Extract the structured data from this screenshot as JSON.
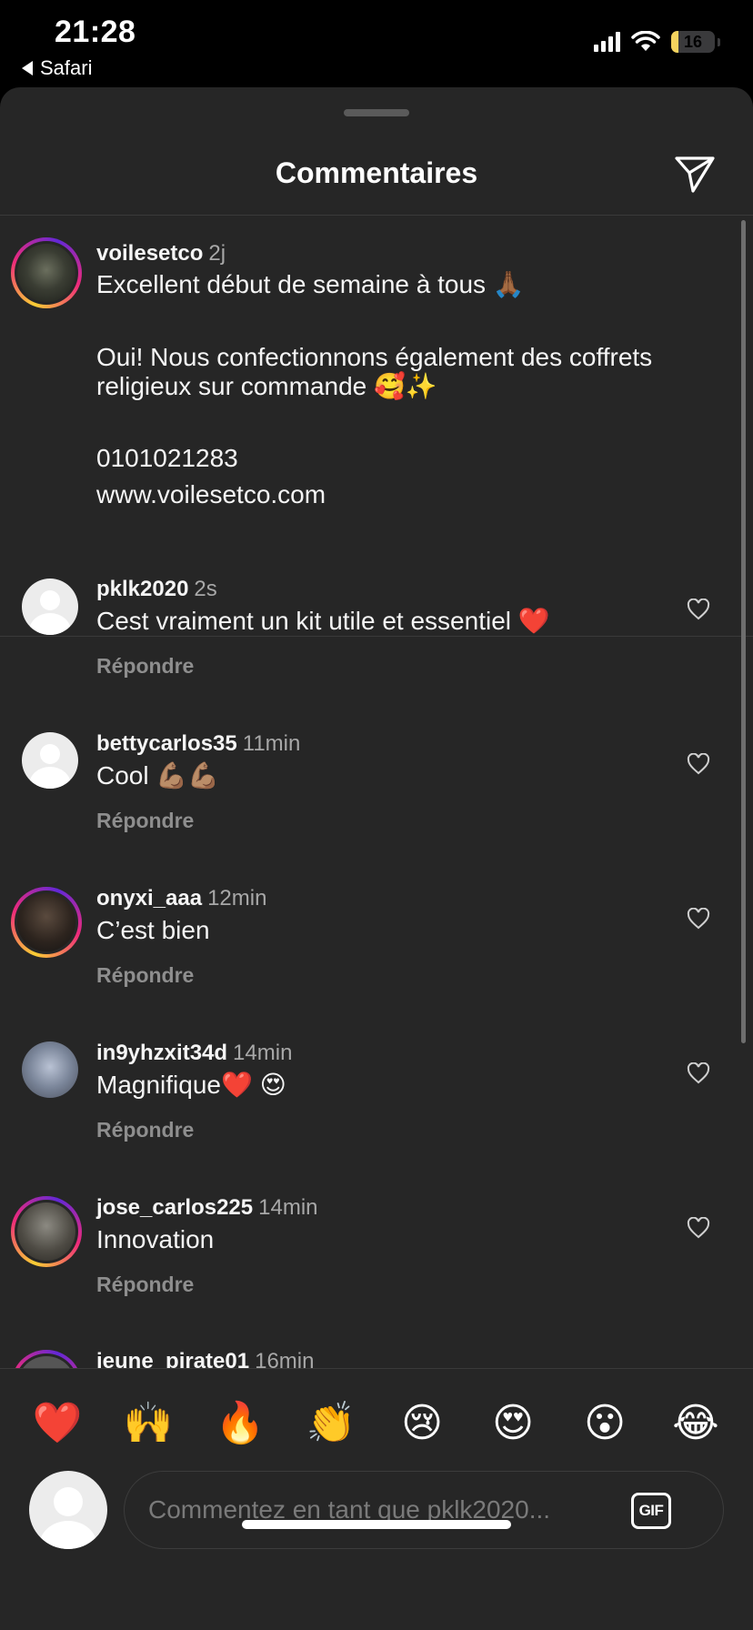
{
  "status_bar": {
    "time": "21:28",
    "back_app": "Safari",
    "battery": "16",
    "battery_level": 0.16,
    "icons": [
      "cellular-signal-icon",
      "wifi-icon",
      "battery-icon"
    ]
  },
  "sheet": {
    "title": "Commentaires",
    "send_icon": "paper-plane-icon"
  },
  "caption": {
    "username": "voilesetco",
    "time": "2j",
    "lines": [
      "Excellent début de semaine à tous 🙏🏾",
      "Oui! Nous confectionnons également des coffrets",
      "religieux sur commande 🥰✨",
      "0101021283",
      "www.voilesetco.com"
    ]
  },
  "reply_label": "Répondre",
  "comments": [
    {
      "username": "pklk2020",
      "time": "2s",
      "text": "Cest vraiment un kit utile et essentiel ❤️"
    },
    {
      "username": "bettycarlos35",
      "time": "11min",
      "text": "Cool 💪🏽💪🏽"
    },
    {
      "username": "onyxi_aaa",
      "time": "12min",
      "text": "C’est bien"
    },
    {
      "username": "in9yhzxit34d",
      "time": "14min",
      "text": "Magnifique❤️ 😍"
    },
    {
      "username": "jose_carlos225",
      "time": "14min",
      "text": "Innovation"
    },
    {
      "username": "jeune_pirate01",
      "time": "16min",
      "text": ""
    }
  ],
  "quick_reactions": [
    "❤️",
    "🙌",
    "🔥",
    "👏",
    "😢",
    "😍",
    "😮",
    "😂"
  ],
  "composer": {
    "placeholder": "Commentez en tant que pklk2020...",
    "gif_label": "GIF"
  },
  "colors": {
    "background": "#262626",
    "muted_text": "#a8a8a8",
    "story_ring": [
      "#f9ce34",
      "#ee2a7b",
      "#6228d7"
    ]
  }
}
